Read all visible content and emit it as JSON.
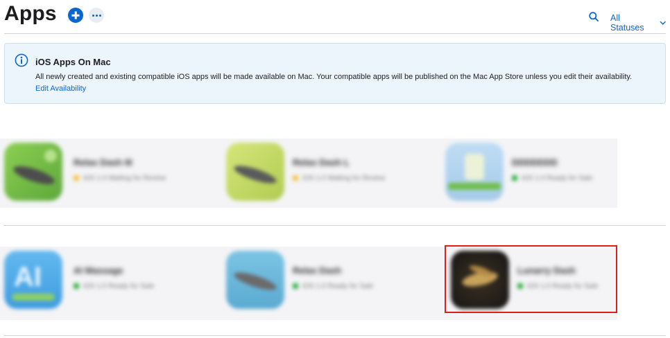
{
  "header": {
    "title": "Apps",
    "add_icon": "plus-circle-icon",
    "more_icon": "ellipsis-icon",
    "search_icon": "search-icon",
    "status_filter": "All Statuses"
  },
  "banner": {
    "title": "iOS Apps On Mac",
    "text": "All newly created and existing compatible iOS apps will be made available on Mac. Your compatible apps will be published on the Mac App Store unless you edit their availability.",
    "link": "Edit Availability",
    "icon": "info-icon"
  },
  "rows": [
    {
      "apps": [
        {
          "name": "Relax Dash III",
          "status": "iOS 1.0 Waiting for Review",
          "status_color": "#f5c144"
        },
        {
          "name": "Relax Dash L",
          "status": "iOS 1.0 Waiting for Review",
          "status_color": "#f5c144"
        },
        {
          "name": "DDDDDDD",
          "status": "iOS 1.0 Ready for Sale",
          "status_color": "#2fb043"
        }
      ]
    },
    {
      "apps": [
        {
          "name": "AI Massage",
          "status": "iOS 1.0 Ready for Sale",
          "status_color": "#2fb043"
        },
        {
          "name": "Relax Dash",
          "status": "iOS 1.0 Ready for Sale",
          "status_color": "#2fb043"
        },
        {
          "name": "Lunarry Dash",
          "status": "iOS 1.0 Ready for Sale",
          "status_color": "#2fb043"
        }
      ]
    }
  ],
  "colors": {
    "accent": "#0b67d0",
    "highlight": "#e31b1b",
    "banner_bg": "#edf5fc"
  }
}
